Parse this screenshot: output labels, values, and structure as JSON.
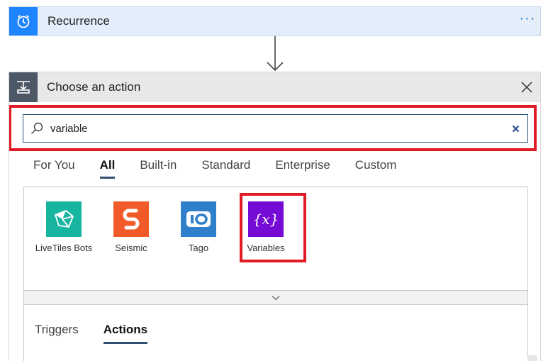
{
  "recurrence": {
    "title": "Recurrence",
    "icon": "alarm-clock-icon",
    "menu_label": "···",
    "accent": "#1f85ff"
  },
  "action_panel": {
    "title": "Choose an action",
    "icon": "insert-step-icon",
    "header_icon_color": "#4d5866"
  },
  "search": {
    "value": "variable",
    "placeholder": "",
    "highlight_color": "#e01b24"
  },
  "category_tabs": [
    {
      "label": "For You",
      "active": false
    },
    {
      "label": "All",
      "active": true
    },
    {
      "label": "Built-in",
      "active": false
    },
    {
      "label": "Standard",
      "active": false
    },
    {
      "label": "Enterprise",
      "active": false
    },
    {
      "label": "Custom",
      "active": false
    }
  ],
  "connectors": [
    {
      "label": "LiveTiles Bots",
      "icon": "livetiles-bots-icon",
      "color": "#17b5a0"
    },
    {
      "label": "Seismic",
      "icon": "seismic-icon",
      "color": "#f15a29"
    },
    {
      "label": "Tago",
      "icon": "tago-icon",
      "color": "#2f7fcb"
    },
    {
      "label": "Variables",
      "icon": "variables-icon",
      "color": "#770bd6",
      "glyph": "{x}"
    }
  ],
  "result_tabs": [
    {
      "label": "Triggers",
      "active": false
    },
    {
      "label": "Actions",
      "active": true
    }
  ]
}
